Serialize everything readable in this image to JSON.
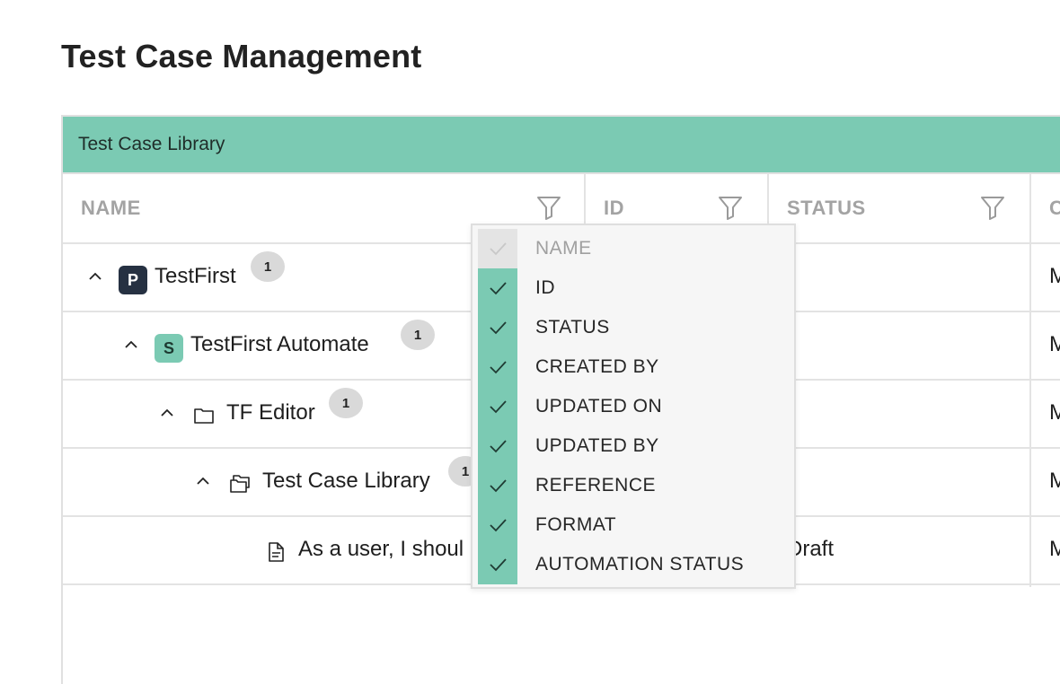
{
  "page": {
    "title": "Test Case Management"
  },
  "panel": {
    "header": "Test Case Library"
  },
  "columns": {
    "name": "NAME",
    "id": "ID",
    "status": "STATUS",
    "next": "C"
  },
  "rows": [
    {
      "name": "TestFirst",
      "badge": "1",
      "icon": "P",
      "third_col": "M"
    },
    {
      "name": "TestFirst Automate",
      "badge": "1",
      "icon": "S",
      "third_col": "M"
    },
    {
      "name": "TF Editor",
      "badge": "1",
      "icon": "folder-icon",
      "third_col": "M"
    },
    {
      "name": "Test Case Library",
      "badge": "1",
      "icon": "folders-icon",
      "third_col": "M"
    },
    {
      "name": "As a user, I shoul",
      "status": "Draft",
      "icon": "document-icon",
      "third_col": "M"
    }
  ],
  "column_menu": {
    "items": [
      {
        "label": "NAME",
        "checked": true,
        "disabled": true
      },
      {
        "label": "ID",
        "checked": true
      },
      {
        "label": "STATUS",
        "checked": true
      },
      {
        "label": "CREATED BY",
        "checked": true
      },
      {
        "label": "UPDATED ON",
        "checked": true
      },
      {
        "label": "UPDATED BY",
        "checked": true
      },
      {
        "label": "REFERENCE",
        "checked": true
      },
      {
        "label": "FORMAT",
        "checked": true
      },
      {
        "label": "AUTOMATION STATUS",
        "checked": true
      }
    ]
  },
  "colors": {
    "accent": "#7bcab3",
    "project_icon": "#263142"
  }
}
